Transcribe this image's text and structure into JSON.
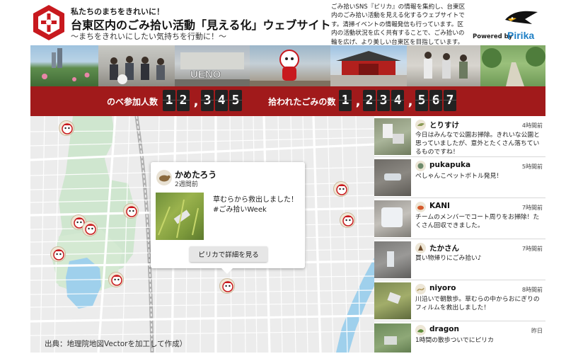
{
  "header": {
    "tagline": "私たちのまちをきれいに！",
    "title": "台東区内のごみ拾い活動「見える化」ウェブサイト",
    "subtitle": "〜まちをきれいにしたい気持ちを行動に！〜",
    "description": "ごみ拾いSNS『ピリカ』の情報を集約し、台東区内のごみ拾い活動を見える化するウェブサイトです。清掃イベントの情報発信も行っています。区内の活動状況を広く共有することで、ごみ拾いの輪を広げ、より美しい台東区を目指しています。",
    "powered_by": "Powered by",
    "brand": "Pirika",
    "emblem_icon": "city-emblem-icon",
    "brand_icon": "bird-logo-icon"
  },
  "counters": {
    "participants_label": "のべ参加人数",
    "participants_digits": [
      "1",
      "2",
      ",",
      "3",
      "4",
      "5"
    ],
    "trash_label": "拾われたごみの数",
    "trash_digits": [
      "1",
      ",",
      "2",
      "3",
      "4",
      ",",
      "5",
      "6",
      "7"
    ]
  },
  "map": {
    "credit": "出典：地理院地図Vectorを加工して作成）",
    "popup": {
      "user": "かめたろう",
      "time": "2週間前",
      "text": "草むらから救出しました！ #ごみ拾いWeek",
      "button_label": "ピリカで詳細を見る"
    }
  },
  "feed": [
    {
      "user": "とりすけ",
      "time": "4時間前",
      "text": "今日はみんなで公園お掃除。きれいな公園と思っていましたが、意外とたくさん落ちているものですね！"
    },
    {
      "user": "pukapuka",
      "time": "5時間前",
      "text": "ぺしゃんこペットボトル発見！"
    },
    {
      "user": "KANI",
      "time": "7時間前",
      "text": "チームのメンバーでコート周りをお掃除！たくさん回収できました。"
    },
    {
      "user": "たかさん",
      "time": "7時間前",
      "text": "買い物帰りにごみ拾い♪"
    },
    {
      "user": "niyoro",
      "time": "8時間前",
      "text": "川沿いで朝散歩。草むらの中からおにぎりのフィルムを救出しました！"
    },
    {
      "user": "dragon",
      "time": "昨日",
      "text": "1時間の散歩ついでにピリカ"
    }
  ],
  "colors": {
    "accent_red": "#a11a1b",
    "brand_blue": "#1e7fc5",
    "park_green": "#cfe6cf",
    "water_blue": "#9fd0ec"
  }
}
